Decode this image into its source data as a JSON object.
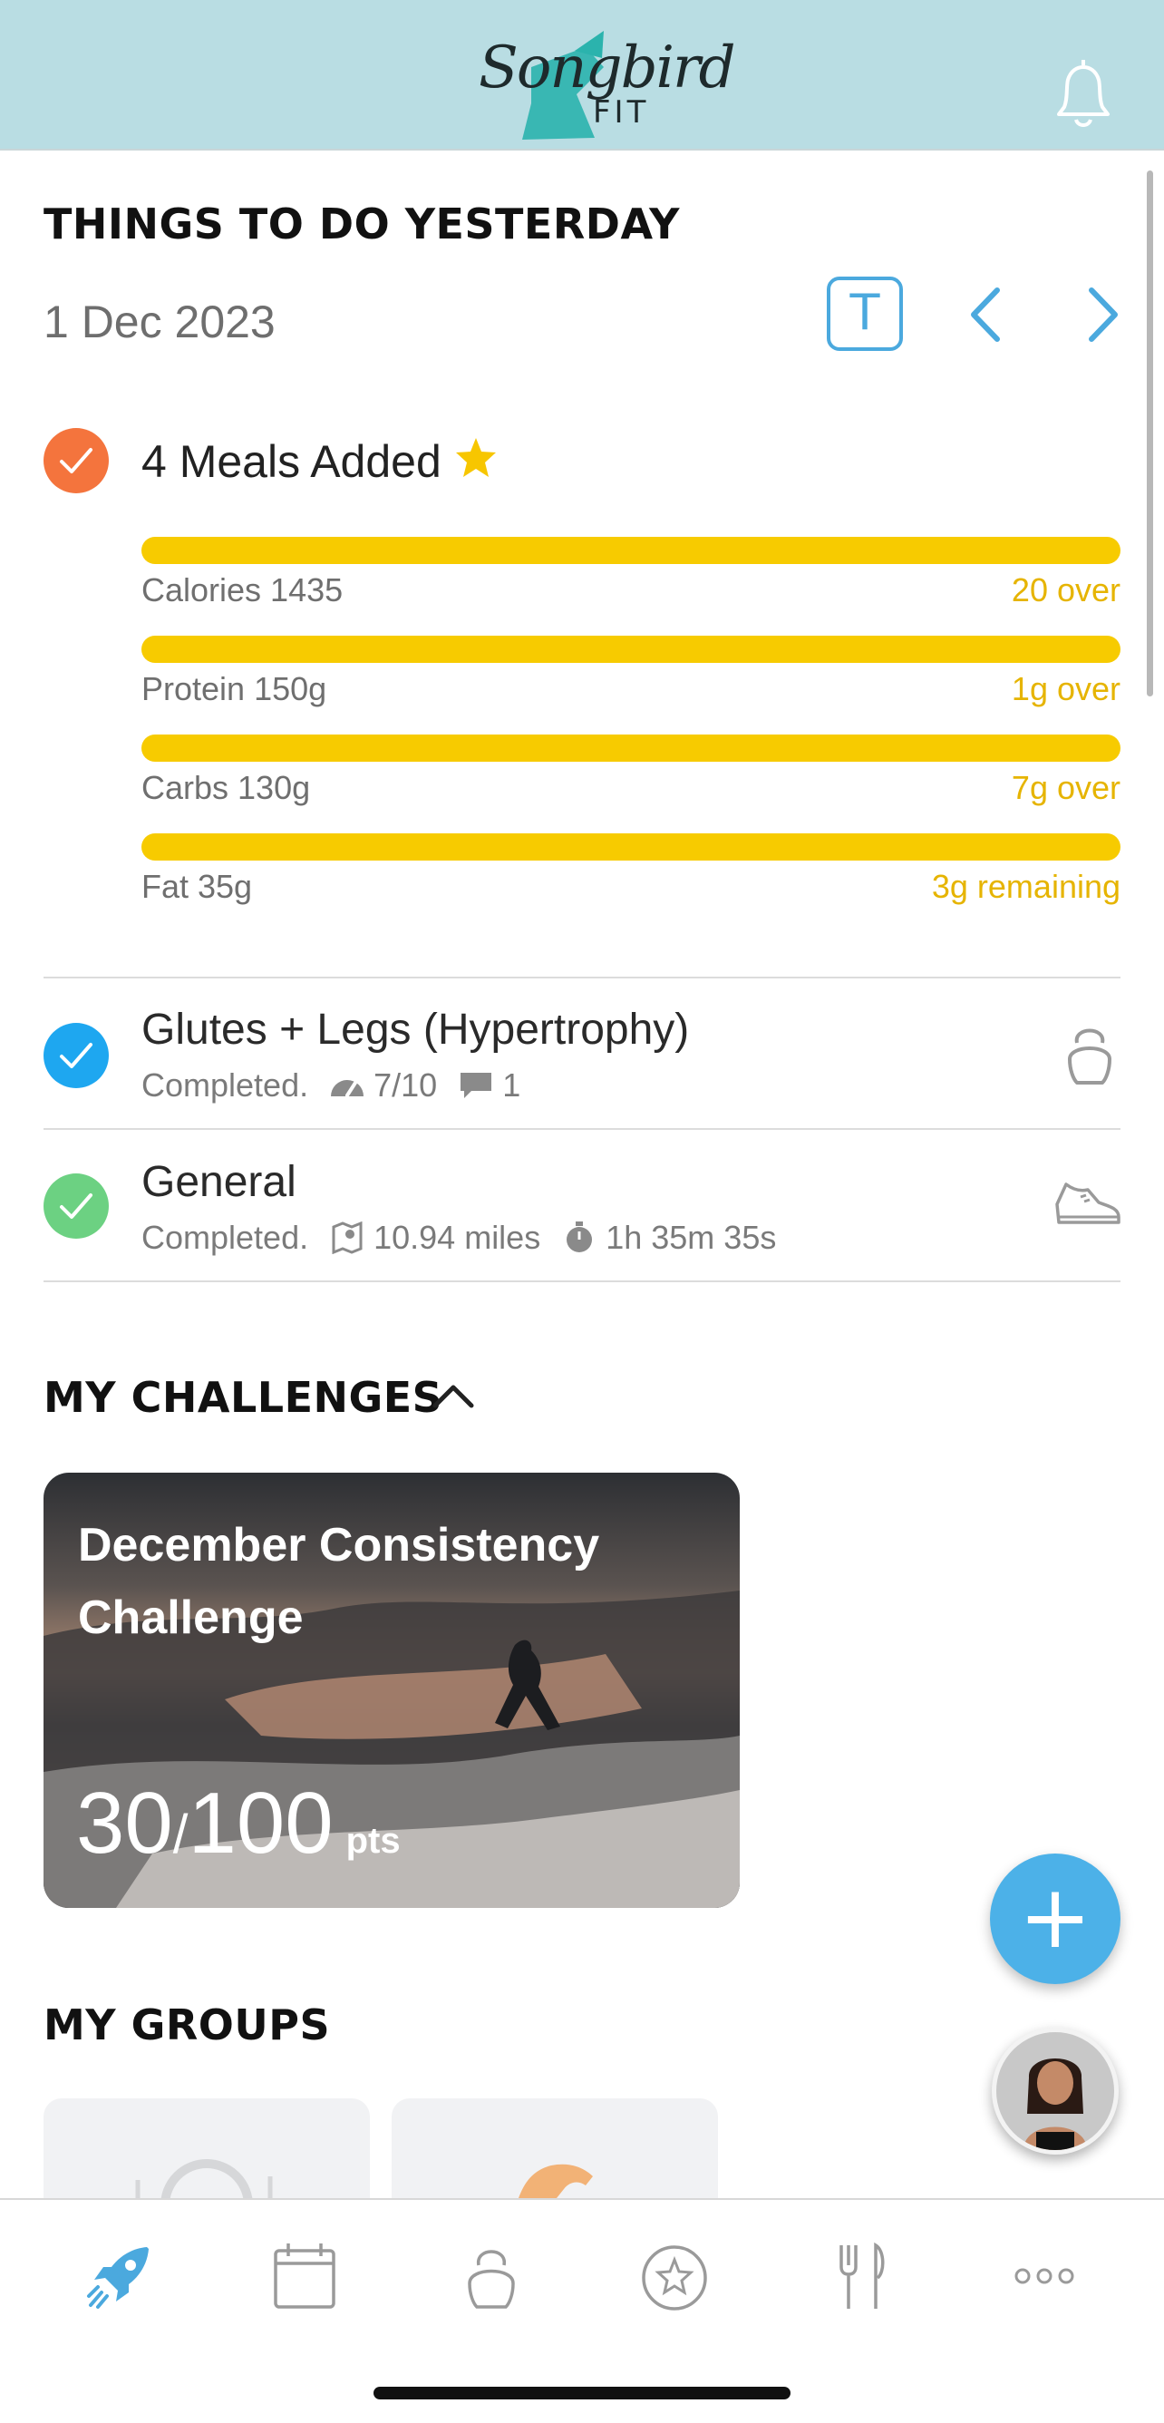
{
  "header": {
    "logo_text": "Songbird",
    "logo_sub": "FIT",
    "bell_icon": "bell-icon"
  },
  "todo": {
    "title": "THINGS TO DO YESTERDAY",
    "date": "1 Dec 2023",
    "today_button": "T",
    "meals": {
      "label": "4 Meals Added",
      "macros": [
        {
          "label": "Calories 1435",
          "status": "20 over",
          "fraction": 1.0
        },
        {
          "label": "Protein 150g",
          "status": "1g over",
          "fraction": 1.0
        },
        {
          "label": "Carbs 130g",
          "status": "7g over",
          "fraction": 1.0
        },
        {
          "label": "Fat 35g",
          "status": "3g remaining",
          "fraction": 1.0
        }
      ]
    },
    "activities": [
      {
        "title": "Glutes + Legs (Hypertrophy)",
        "status": "Completed.",
        "rating": "7/10",
        "comments": "1",
        "icon": "kettlebell-icon",
        "check_color": "#1ea7f0"
      },
      {
        "title": "General",
        "status": "Completed.",
        "distance": "10.94 miles",
        "duration": "1h 35m 35s",
        "icon": "shoe-icon",
        "check_color": "#6cd182"
      }
    ]
  },
  "challenges": {
    "title": "MY CHALLENGES",
    "card": {
      "title": "December Consistency Challenge",
      "points": "30",
      "separator": "/",
      "total": "100",
      "unit": "pts"
    }
  },
  "groups": {
    "title": "MY GROUPS"
  },
  "fab": {
    "label": "+"
  },
  "tabbar": {
    "items": [
      "rocket-icon",
      "calendar-icon",
      "kettlebell-icon",
      "badge-star-icon",
      "fork-knife-icon",
      "more-icon"
    ]
  },
  "colors": {
    "accent": "#4ba9de",
    "macro_bar": "#f7cb00",
    "header_bg": "#b9dde3",
    "meal_check": "#f4743d"
  }
}
